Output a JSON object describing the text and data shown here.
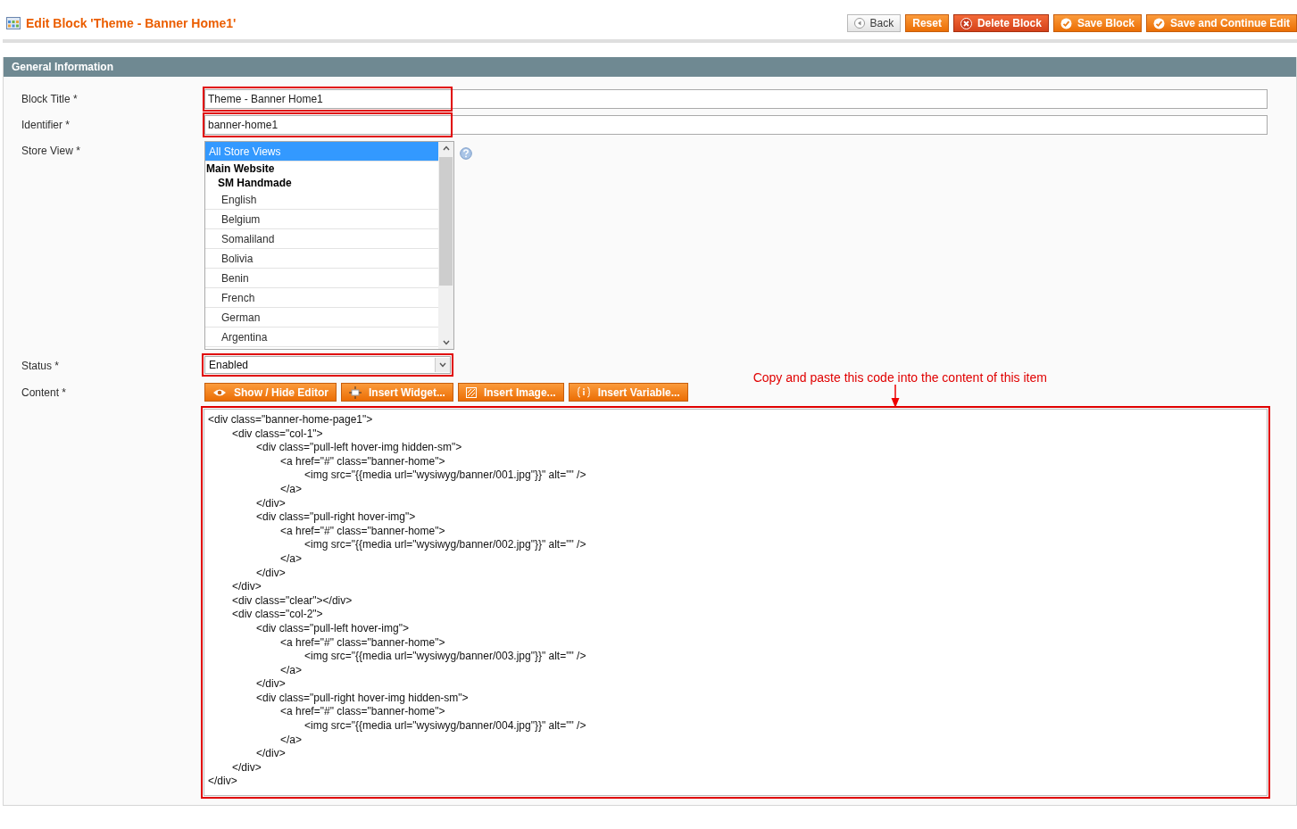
{
  "page_title": "Edit Block 'Theme - Banner Home1'",
  "actions": [
    {
      "label": "Back",
      "kind": "back"
    },
    {
      "label": "Reset",
      "kind": "plain"
    },
    {
      "label": "Delete Block",
      "kind": "delete"
    },
    {
      "label": "Save Block",
      "kind": "save"
    },
    {
      "label": "Save and Continue Edit",
      "kind": "save"
    }
  ],
  "section": {
    "title": "General Information"
  },
  "block_title": {
    "label": "Block Title",
    "required_mark": "*",
    "value": "Theme - Banner Home1",
    "highlighted": true
  },
  "identifier": {
    "label": "Identifier",
    "required_mark": "*",
    "value": "banner-home1",
    "highlighted": true
  },
  "store_view": {
    "label": "Store View",
    "required_mark": "*",
    "options": [
      {
        "label": "All Store Views",
        "kind": "option",
        "selected": true
      },
      {
        "label": "Main Website",
        "kind": "group",
        "children": [
          {
            "label": "SM Handmade",
            "kind": "group",
            "children": [
              {
                "label": "English",
                "kind": "option",
                "selected": false
              },
              {
                "label": "Belgium",
                "kind": "option",
                "selected": false
              },
              {
                "label": "Somaliland",
                "kind": "option",
                "selected": false
              },
              {
                "label": "Bolivia",
                "kind": "option",
                "selected": false
              },
              {
                "label": "Benin",
                "kind": "option",
                "selected": false
              },
              {
                "label": "French",
                "kind": "option",
                "selected": false
              },
              {
                "label": "German",
                "kind": "option",
                "selected": false
              },
              {
                "label": "Argentina",
                "kind": "option",
                "selected": false
              }
            ]
          }
        ]
      }
    ]
  },
  "status": {
    "label": "Status",
    "required_mark": "*",
    "value": "Enabled",
    "highlighted": true
  },
  "content": {
    "label": "Content",
    "required_mark": "*",
    "highlighted": true,
    "editor_buttons": [
      {
        "label": "Show / Hide Editor",
        "kind": "eye"
      },
      {
        "label": "Insert Widget...",
        "kind": "widget"
      },
      {
        "label": "Insert Image...",
        "kind": "image"
      },
      {
        "label": "Insert Variable...",
        "kind": "variable"
      }
    ],
    "annotation": "Copy and paste this code into the content of this item",
    "value": "<div class=\"banner-home-page1\">\n\t<div class=\"col-1\">\n\t\t<div class=\"pull-left hover-img hidden-sm\">\n\t\t\t<a href=\"#\" class=\"banner-home\">\n\t\t\t\t<img src=\"{{media url=\"wysiwyg/banner/001.jpg\"}}\" alt=\"\" />\n\t\t\t</a>\n\t\t</div>\n\t\t<div class=\"pull-right hover-img\">\n\t\t\t<a href=\"#\" class=\"banner-home\">\n\t\t\t\t<img src=\"{{media url=\"wysiwyg/banner/002.jpg\"}}\" alt=\"\" />\n\t\t\t</a>\n\t\t</div>\n\t</div>\n\t<div class=\"clear\"></div>\n\t<div class=\"col-2\">\n\t\t<div class=\"pull-left hover-img\">\n\t\t\t<a href=\"#\" class=\"banner-home\">\n\t\t\t\t<img src=\"{{media url=\"wysiwyg/banner/003.jpg\"}}\" alt=\"\" />\n\t\t\t</a>\n\t\t</div>\n\t\t<div class=\"pull-right hover-img hidden-sm\">\n\t\t\t<a href=\"#\" class=\"banner-home\">\n\t\t\t\t<img src=\"{{media url=\"wysiwyg/banner/004.jpg\"}}\" alt=\"\" />\n\t\t\t</a>\n\t\t</div>\n\t</div>\n</div>"
  }
}
